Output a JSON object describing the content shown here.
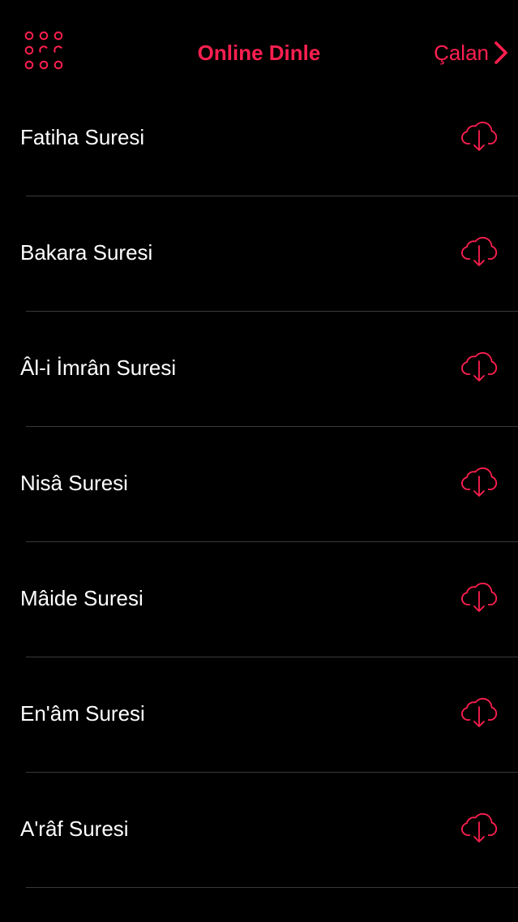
{
  "theme": {
    "accent": "#FF1F4F",
    "background": "#000000",
    "text": "#FFFFFF",
    "separator": "#3A3A3C"
  },
  "nav": {
    "menu_icon": "grid-dots-icon",
    "title": "Online Dinle",
    "now_playing_label": "Çalan",
    "now_playing_icon": "chevron-right-icon"
  },
  "surahs": [
    {
      "label": "Fatiha Suresi",
      "action_icon": "cloud-download-icon"
    },
    {
      "label": "Bakara Suresi",
      "action_icon": "cloud-download-icon"
    },
    {
      "label": "Âl-i İmrân Suresi",
      "action_icon": "cloud-download-icon"
    },
    {
      "label": "Nisâ Suresi",
      "action_icon": "cloud-download-icon"
    },
    {
      "label": "Mâide Suresi",
      "action_icon": "cloud-download-icon"
    },
    {
      "label": "En'âm Suresi",
      "action_icon": "cloud-download-icon"
    },
    {
      "label": "A'râf Suresi",
      "action_icon": "cloud-download-icon"
    }
  ]
}
